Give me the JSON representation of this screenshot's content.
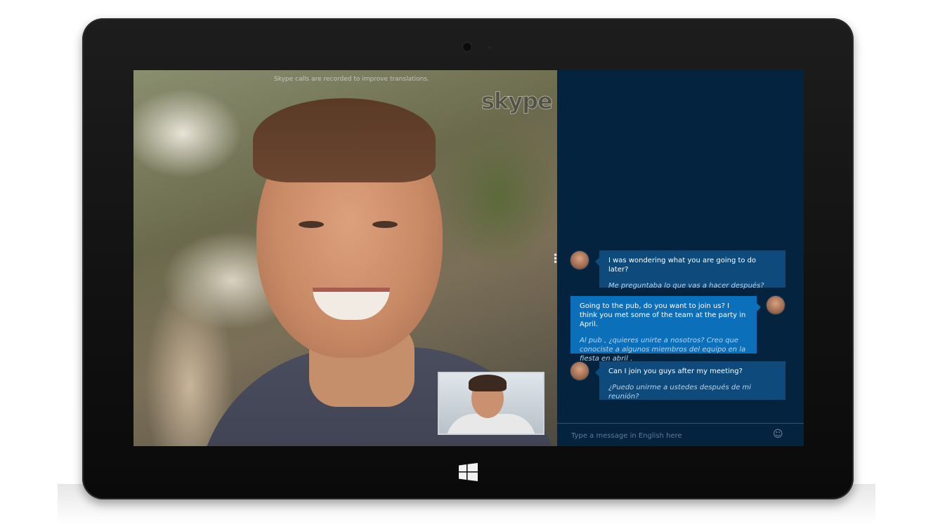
{
  "video": {
    "watermark": "Skype calls are recorded to improve translations.",
    "logo_text": "skype"
  },
  "chat": {
    "messages": [
      {
        "direction": "incoming",
        "text": "I was wondering what you are going to do later?",
        "translation": "Me preguntaba lo que vas a hacer después?"
      },
      {
        "direction": "outgoing",
        "text": "Going to the pub, do you want to join us? I think you met some of the team at the party in April.",
        "translation": "Al pub , ¿quieres unirte a nosotros? Creo que conociste a algunos miembros del equipo en la fiesta en abril ."
      },
      {
        "direction": "incoming",
        "text": "Can I join you guys after my meeting?",
        "translation": "¿Puedo unirme a ustedes después de mi reunión?"
      }
    ],
    "composer": {
      "placeholder": "Type a message in English here",
      "emoji_icon": "smiley-icon"
    }
  },
  "device": {
    "home_button_icon": "windows-logo-icon"
  },
  "colors": {
    "chat_background": "#03233f",
    "incoming_bubble": "#0f4a7c",
    "outgoing_bubble": "#0c6fba",
    "translation_text": "#b8d4ec"
  }
}
